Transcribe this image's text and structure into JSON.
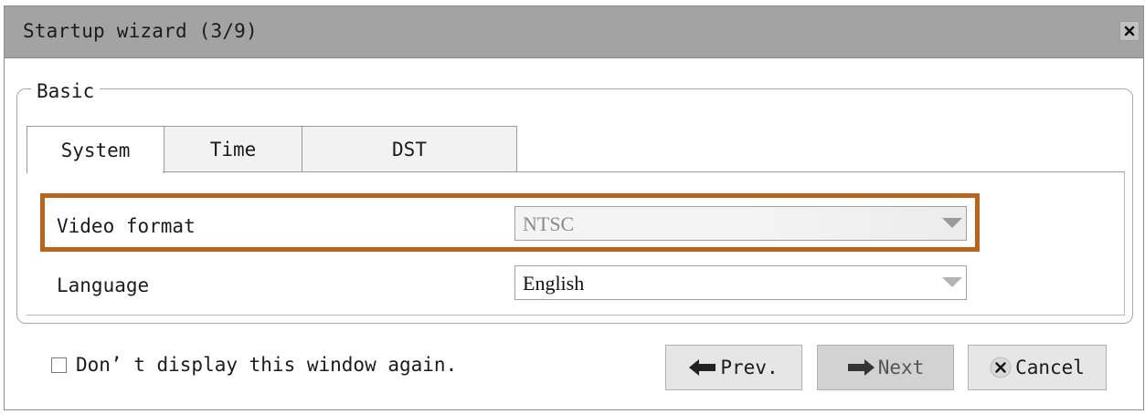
{
  "window": {
    "title": "Startup wizard (3/9)",
    "close_icon": "close-icon"
  },
  "group": {
    "legend": "Basic"
  },
  "tabs": [
    {
      "label": "System",
      "active": true
    },
    {
      "label": "Time",
      "active": false
    },
    {
      "label": "DST",
      "active": false
    }
  ],
  "fields": {
    "video_format": {
      "label": "Video format",
      "value": "NTSC",
      "disabled": true
    },
    "language": {
      "label": "Language",
      "value": "English",
      "disabled": false
    }
  },
  "footer": {
    "dont_display_label": "Don’ t display this window again.",
    "dont_display_checked": false,
    "prev_label": "Prev.",
    "next_label": "Next",
    "cancel_label": "Cancel"
  },
  "colors": {
    "highlight": "#b8641c",
    "titlebar": "#a3a3a3"
  }
}
